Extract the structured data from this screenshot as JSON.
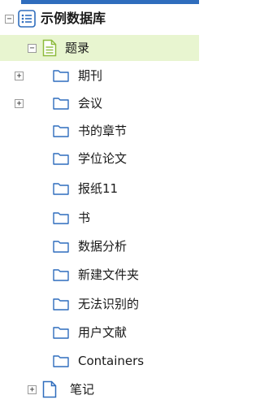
{
  "tree": {
    "root": {
      "label": "示例数据库",
      "expander": "−"
    },
    "group": {
      "label": "题录",
      "expander": "−"
    },
    "children": [
      {
        "label": "期刊",
        "expander": "+"
      },
      {
        "label": "会议",
        "expander": "+"
      },
      {
        "label": "书的章节"
      },
      {
        "label": "学位论文"
      },
      {
        "label": "报纸11"
      },
      {
        "label": "书"
      },
      {
        "label": "数据分析"
      },
      {
        "label": "新建文件夹"
      },
      {
        "label": "无法识别的"
      },
      {
        "label": "用户文献"
      },
      {
        "label": "Containers"
      }
    ],
    "notes": {
      "label": "笔记",
      "expander": "+"
    }
  },
  "colors": {
    "accent": "#2f6dbd",
    "selected_bg": "#e8f5d0",
    "group_icon": "#8dbb3c"
  }
}
